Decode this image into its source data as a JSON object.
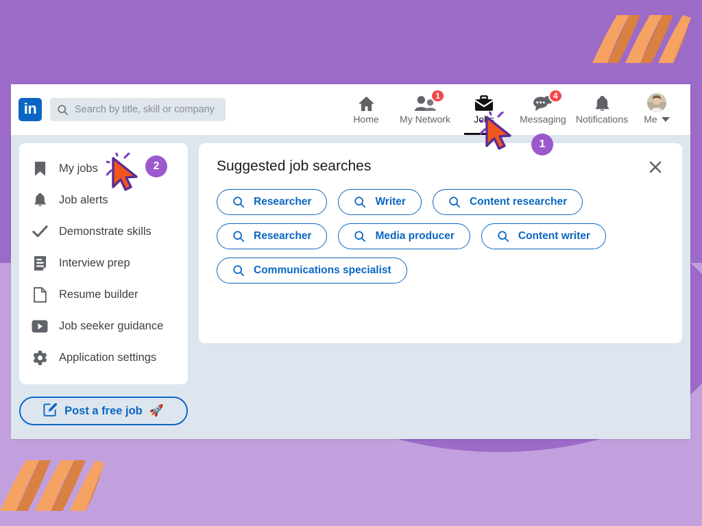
{
  "theme": {
    "bg_purple": "#9c6bc8",
    "bg_purple_light": "#c2a0dd",
    "stripe_orange": "#f5a263",
    "stripe_orange_dark": "#d98043",
    "linkedin_blue": "#0a66c2",
    "window_bg": "#dde6ef",
    "badge_red": "#f4474a",
    "annotation_purple": "#9b59cd",
    "cursor_orange": "#f2561f",
    "cursor_outline": "#5b2d91"
  },
  "topbar": {
    "logo_text": "in",
    "logo_icon": "linkedin-logo",
    "search": {
      "icon": "search-icon",
      "placeholder": "Search by title, skill or company",
      "value": ""
    },
    "nav": [
      {
        "id": "home",
        "label": "Home",
        "icon": "home-icon",
        "badge": "",
        "active": false
      },
      {
        "id": "my-network",
        "label": "My Network",
        "icon": "people-icon",
        "badge": "1",
        "active": false
      },
      {
        "id": "jobs",
        "label": "Jobs",
        "icon": "briefcase-icon",
        "badge": "",
        "active": true
      },
      {
        "id": "messaging",
        "label": "Messaging",
        "icon": "chat-bubble-icon",
        "badge": "4",
        "active": false
      },
      {
        "id": "notifications",
        "label": "Notifications",
        "icon": "bell-icon",
        "badge": "",
        "active": false
      }
    ],
    "me": {
      "label": "Me",
      "icon": "avatar",
      "caret": "chevron-down-icon"
    }
  },
  "sidebar": {
    "items": [
      {
        "label": "My jobs",
        "icon": "bookmark-icon"
      },
      {
        "label": "Job alerts",
        "icon": "bell-icon"
      },
      {
        "label": "Demonstrate skills",
        "icon": "check-icon"
      },
      {
        "label": "Interview prep",
        "icon": "document-lines-icon"
      },
      {
        "label": "Resume builder",
        "icon": "page-icon"
      },
      {
        "label": "Job seeker guidance",
        "icon": "video-play-icon"
      },
      {
        "label": "Application settings",
        "icon": "gear-icon"
      }
    ],
    "post_job": {
      "label": "Post a free job",
      "icon": "edit-square-icon",
      "emoji": "🚀"
    }
  },
  "main": {
    "title": "Suggested job searches",
    "close_icon": "close-icon",
    "chip_icon": "search-icon",
    "chip_rows": [
      [
        "Researcher",
        "Writer",
        "Content researcher"
      ],
      [
        "Researcher",
        "Media producer",
        "Content writer"
      ],
      [
        "Communications specialist"
      ]
    ]
  },
  "annotations": {
    "steps": [
      {
        "number": "1",
        "target": "jobs-nav-item"
      },
      {
        "number": "2",
        "target": "sidebar-item-my-jobs"
      }
    ]
  }
}
